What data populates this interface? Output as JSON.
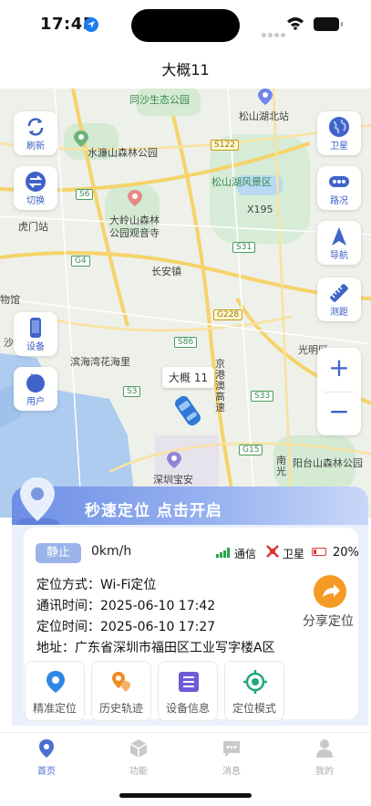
{
  "status_bar": {
    "time": "17:45"
  },
  "header": {
    "title": "大概11"
  },
  "map": {
    "labels": [
      {
        "text": "同沙生态公园",
        "kind": "green"
      },
      {
        "text": "松山湖北站",
        "kind": "plain"
      },
      {
        "text": "水濂山森林公园",
        "kind": "plain"
      },
      {
        "text": "S122",
        "kind": "shield-yellow"
      },
      {
        "text": "松山湖风景区",
        "kind": "green"
      },
      {
        "text": "S6",
        "kind": "shield"
      },
      {
        "text": "大岭山森林",
        "kind": "plain"
      },
      {
        "text": "公园观音寺",
        "kind": "plain"
      },
      {
        "text": "X195",
        "kind": "plain"
      },
      {
        "text": "虎门站",
        "kind": "plain"
      },
      {
        "text": "S31",
        "kind": "shield"
      },
      {
        "text": "G4",
        "kind": "shield"
      },
      {
        "text": "长安镇",
        "kind": "plain"
      },
      {
        "text": "物馆",
        "kind": "plain"
      },
      {
        "text": "G228",
        "kind": "shield-yellow"
      },
      {
        "text": "沙",
        "kind": "plain"
      },
      {
        "text": "S86",
        "kind": "shield"
      },
      {
        "text": "光明区",
        "kind": "plain"
      },
      {
        "text": "滨海湾花海里",
        "kind": "plain"
      },
      {
        "text": "S3",
        "kind": "shield"
      },
      {
        "text": "S33",
        "kind": "shield"
      },
      {
        "text": "京港澳高速",
        "kind": "plain"
      },
      {
        "text": "G15",
        "kind": "shield"
      },
      {
        "text": "阳台山森林公园",
        "kind": "plain"
      },
      {
        "text": "深圳宝安",
        "kind": "plain"
      },
      {
        "text": "南光",
        "kind": "plain"
      }
    ],
    "vehicle_tag": "大概 11",
    "left_buttons": [
      {
        "label": "刷新",
        "icon": "refresh-icon"
      },
      {
        "label": "切换",
        "icon": "swap-icon"
      },
      {
        "label": "设备",
        "icon": "phone-icon"
      },
      {
        "label": "用户",
        "icon": "user-icon"
      }
    ],
    "right_buttons": [
      {
        "label": "卫星",
        "icon": "globe-icon"
      },
      {
        "label": "路况",
        "icon": "traffic-icon"
      },
      {
        "label": "导航",
        "icon": "navigation-icon"
      },
      {
        "label": "测距",
        "icon": "ruler-icon"
      }
    ],
    "zoom_in": "+",
    "zoom_out": "−"
  },
  "banner": {
    "text": "秒速定位  点击开启"
  },
  "device": {
    "state": "静止",
    "speed": "0km/h",
    "signal_label": "通信",
    "satellite_label": "卫星",
    "battery": "20%",
    "locate_method": "定位方式：Wi-Fi定位",
    "comm_time": "通讯时间：2025-06-10 17:42",
    "locate_time": "定位时间：2025-06-10 17:27",
    "address": "地址：广东省深圳市福田区工业写字楼A区",
    "share_label": "分享定位"
  },
  "actions": [
    {
      "label": "精准定位",
      "icon": "pin-icon"
    },
    {
      "label": "历史轨迹",
      "icon": "track-icon"
    },
    {
      "label": "设备信息",
      "icon": "list-icon"
    },
    {
      "label": "定位模式",
      "icon": "target-icon"
    }
  ],
  "tabs": [
    {
      "label": "首页",
      "icon": "home-pin-icon",
      "active": true
    },
    {
      "label": "功能",
      "icon": "box-icon",
      "active": false
    },
    {
      "label": "消息",
      "icon": "message-icon",
      "active": false
    },
    {
      "label": "我的",
      "icon": "person-icon",
      "active": false
    }
  ],
  "colors": {
    "accent": "#4c6fcf",
    "banner_start": "#6d8ee5",
    "orange": "#f59a25",
    "road_yellow": "#f6d36a",
    "water": "#aecbf0"
  }
}
